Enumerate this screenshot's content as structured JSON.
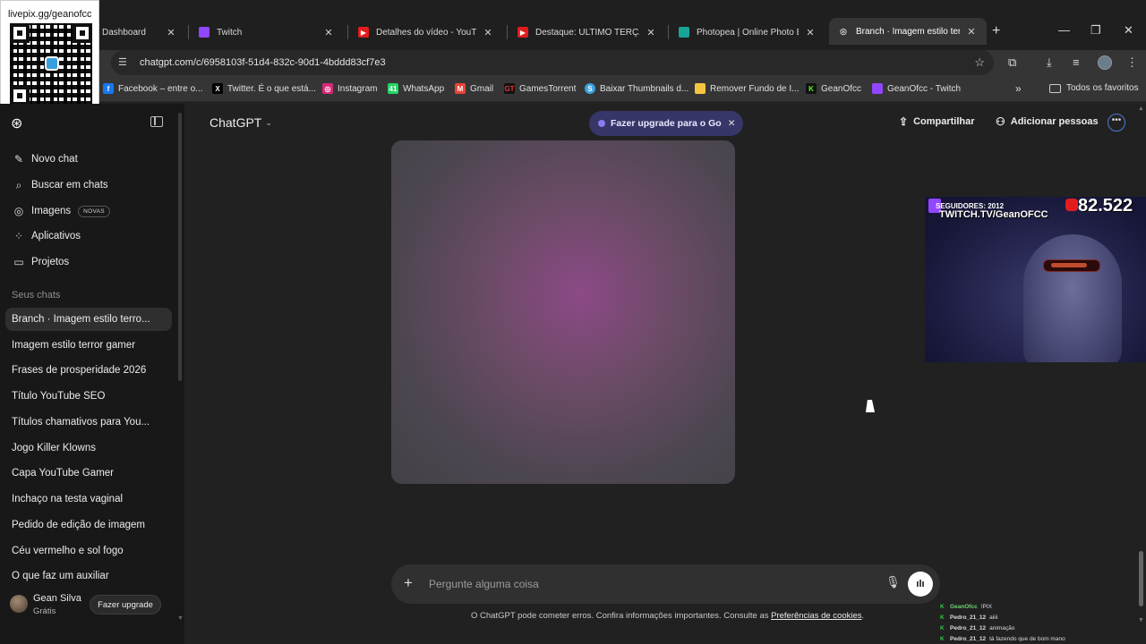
{
  "browser": {
    "tabs": [
      {
        "title": "Dashboard",
        "favicon": "twitch-icon"
      },
      {
        "title": "Twitch",
        "favicon": "twitch-icon"
      },
      {
        "title": "Detalhes do vídeo - YouTube",
        "favicon": "youtube-icon"
      },
      {
        "title": "Destaque: ULTIMO TERÇA D",
        "favicon": "youtube-icon"
      },
      {
        "title": "Photopea | Online Photo Edi",
        "favicon": "photopea-icon"
      },
      {
        "title": "Branch · Imagem estilo terro",
        "favicon": "chatgpt-icon",
        "active": true
      }
    ],
    "url": "chatgpt.com/c/6958103f-51d4-832c-90d1-4bddd83cf7e3",
    "bookmarks": [
      {
        "label": "Facebook – entre o...",
        "icon": "facebook-icon",
        "color": "#1877f2"
      },
      {
        "label": "Twitter. É o que está...",
        "icon": "x-icon",
        "color": "#000000"
      },
      {
        "label": "Instagram",
        "icon": "instagram-icon",
        "color": "#d62976"
      },
      {
        "label": "WhatsApp",
        "icon": "whatsapp-icon",
        "color": "#25d366"
      },
      {
        "label": "Gmail",
        "icon": "gmail-icon",
        "color": "#ea4335"
      },
      {
        "label": "GamesTorrent",
        "icon": "gamestorrent-icon",
        "color": "#111111"
      },
      {
        "label": "Baixar Thumbnails d...",
        "icon": "thumbnails-icon",
        "color": "#3ba3e0"
      },
      {
        "label": "Remover Fundo de I...",
        "icon": "removebg-icon",
        "color": "#f5c542"
      },
      {
        "label": "GeanOfcc",
        "icon": "kick-icon",
        "color": "#53fc18"
      },
      {
        "label": "GeanOfcc - Twitch",
        "icon": "twitch-icon",
        "color": "#9146ff"
      }
    ],
    "all_bookmarks": "Todos os favoritos"
  },
  "overlay": {
    "qr_label": "livepix.gg/geanofcc",
    "followers": "SEGUIDORES: 2012",
    "twitch_url": "TWITCH.TV/GeanOFCC",
    "youtube_count": "82.522",
    "chat": [
      {
        "user": "GeanOfcc",
        "msg": "!PIX"
      },
      {
        "user": "Pedro_21_12",
        "msg": "aiiii"
      },
      {
        "user": "Pedro_21_12",
        "msg": "animação"
      },
      {
        "user": "Pedro_21_12",
        "msg": "tá fazendo que de bom mano"
      }
    ]
  },
  "sidebar": {
    "nav": [
      {
        "label": "Novo chat",
        "icon": "pencil-icon"
      },
      {
        "label": "Buscar em chats",
        "icon": "search-icon"
      },
      {
        "label": "Imagens",
        "icon": "images-icon",
        "badge": "NOVAS"
      },
      {
        "label": "Aplicativos",
        "icon": "apps-icon"
      },
      {
        "label": "Projetos",
        "icon": "folder-icon"
      }
    ],
    "section_title": "Seus chats",
    "chats": [
      "Branch · Imagem estilo terro...",
      "Imagem estilo terror gamer",
      "Frases de prosperidade 2026",
      "Título YouTube SEO",
      "Títulos chamativos para You...",
      "Jogo Killer Klowns",
      "Capa YouTube Gamer",
      "Inchaço na testa vaginal",
      "Pedido de edição de imagem",
      "Céu vermelho e sol fogo",
      "O que faz um auxiliar"
    ],
    "user": {
      "name": "Gean Silva",
      "plan": "Grátis",
      "upgrade": "Fazer upgrade"
    }
  },
  "header": {
    "model": "ChatGPT",
    "upgrade_pill": "Fazer upgrade para o Go",
    "share": "Compartilhar",
    "add_people": "Adicionar pessoas"
  },
  "composer": {
    "placeholder": "Pergunte alguma coisa",
    "disclaimer": "O ChatGPT pode cometer erros. Confira informações importantes. Consulte as",
    "disclaimer_link": "Preferências de cookies",
    "disclaimer_end": "."
  },
  "colors": {
    "sidebar_bg": "#181818",
    "main_bg": "#212121",
    "upgrade_pill_bg": "#373669"
  }
}
